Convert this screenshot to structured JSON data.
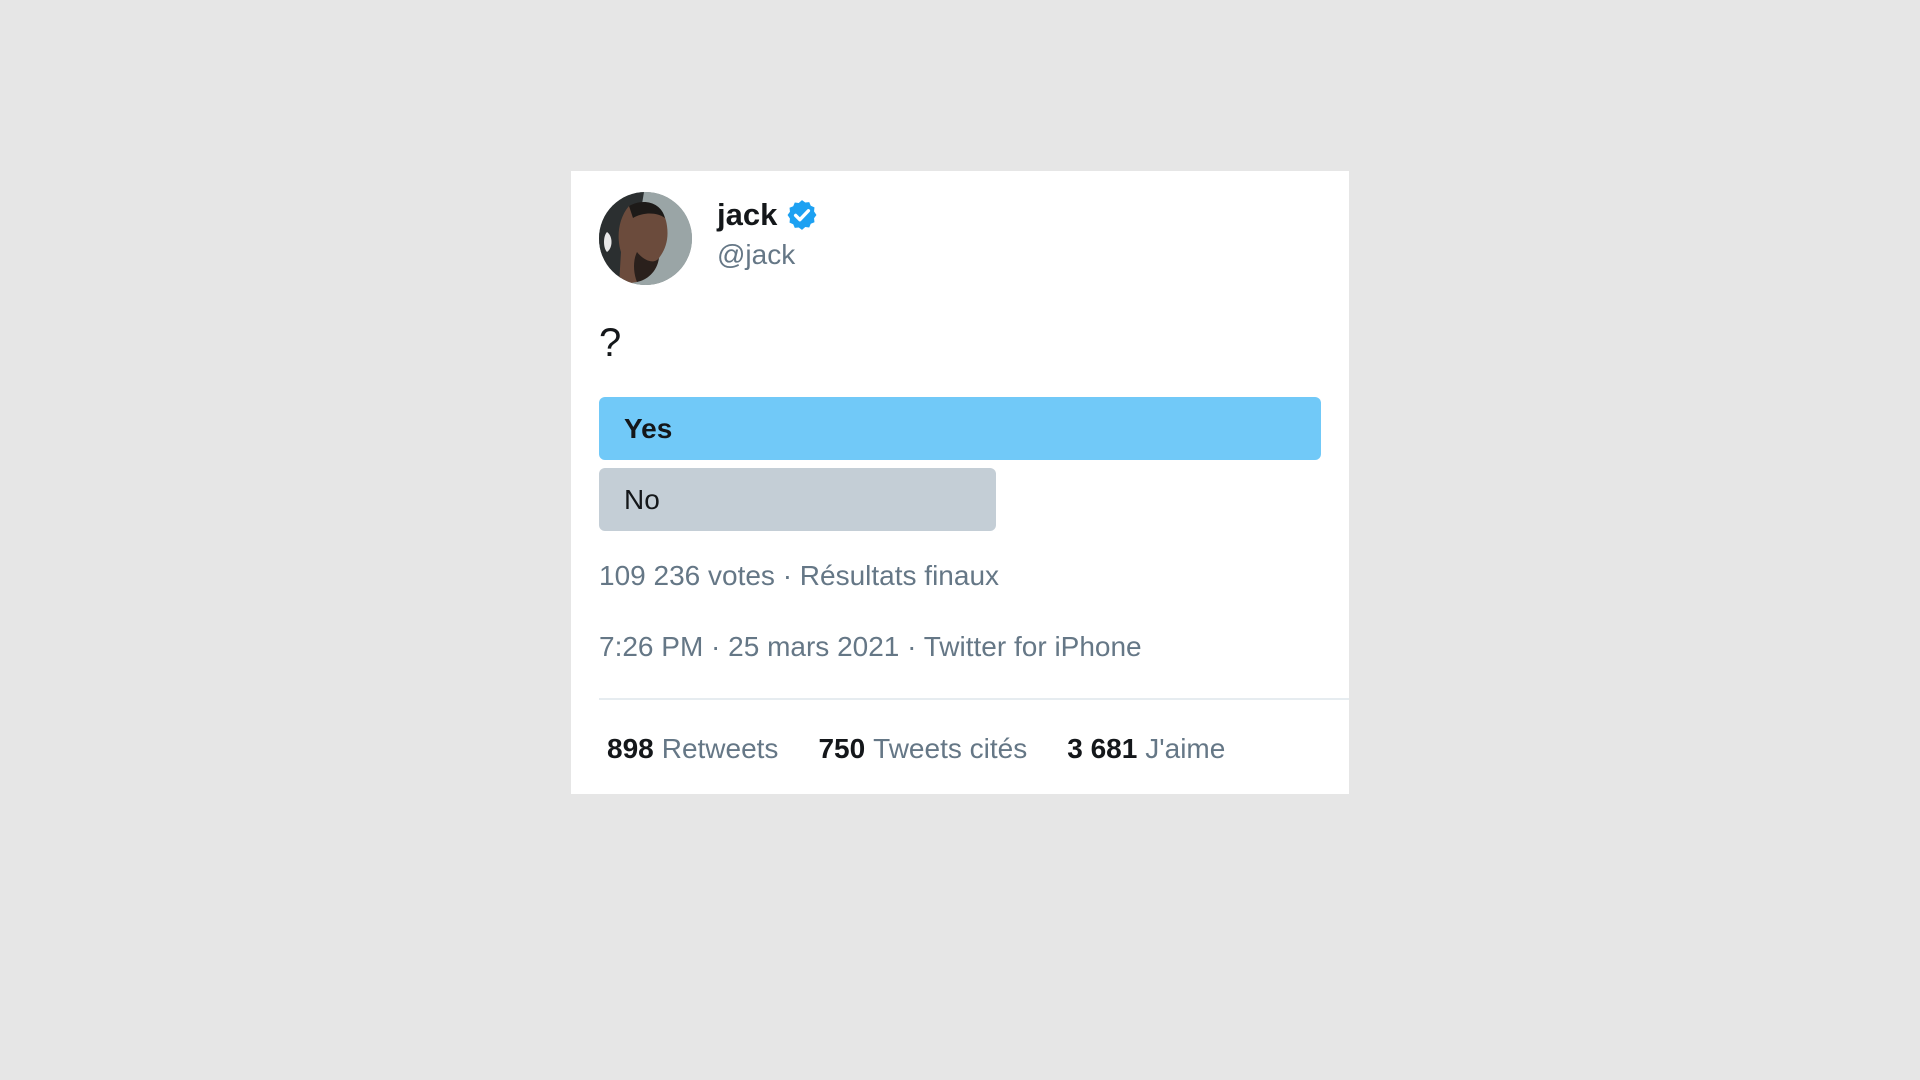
{
  "user": {
    "name": "jack",
    "handle": "@jack",
    "verified": true
  },
  "tweet": {
    "text": "?"
  },
  "poll": {
    "options": [
      {
        "label": "Yes",
        "share": 1.0,
        "winner": true
      },
      {
        "label": "No",
        "share": 0.55,
        "winner": false
      }
    ],
    "meta": "109 236 votes · Résultats finaux"
  },
  "timestamp": "7:26 PM · 25 mars 2021 · Twitter for iPhone",
  "stats": {
    "retweets": {
      "count": "898",
      "label": "Retweets"
    },
    "quotes": {
      "count": "750",
      "label": "Tweets cités"
    },
    "likes": {
      "count": "3 681",
      "label": "J'aime"
    }
  },
  "colors": {
    "page_bg": "#e6e6e6",
    "card_bg": "#ffffff",
    "poll_winner": "#71c9f8",
    "poll_other": "#c4ced6",
    "verified_blue": "#1da1f2",
    "secondary_text": "#657786"
  },
  "icons": {
    "verified": "verified-badge-icon"
  }
}
